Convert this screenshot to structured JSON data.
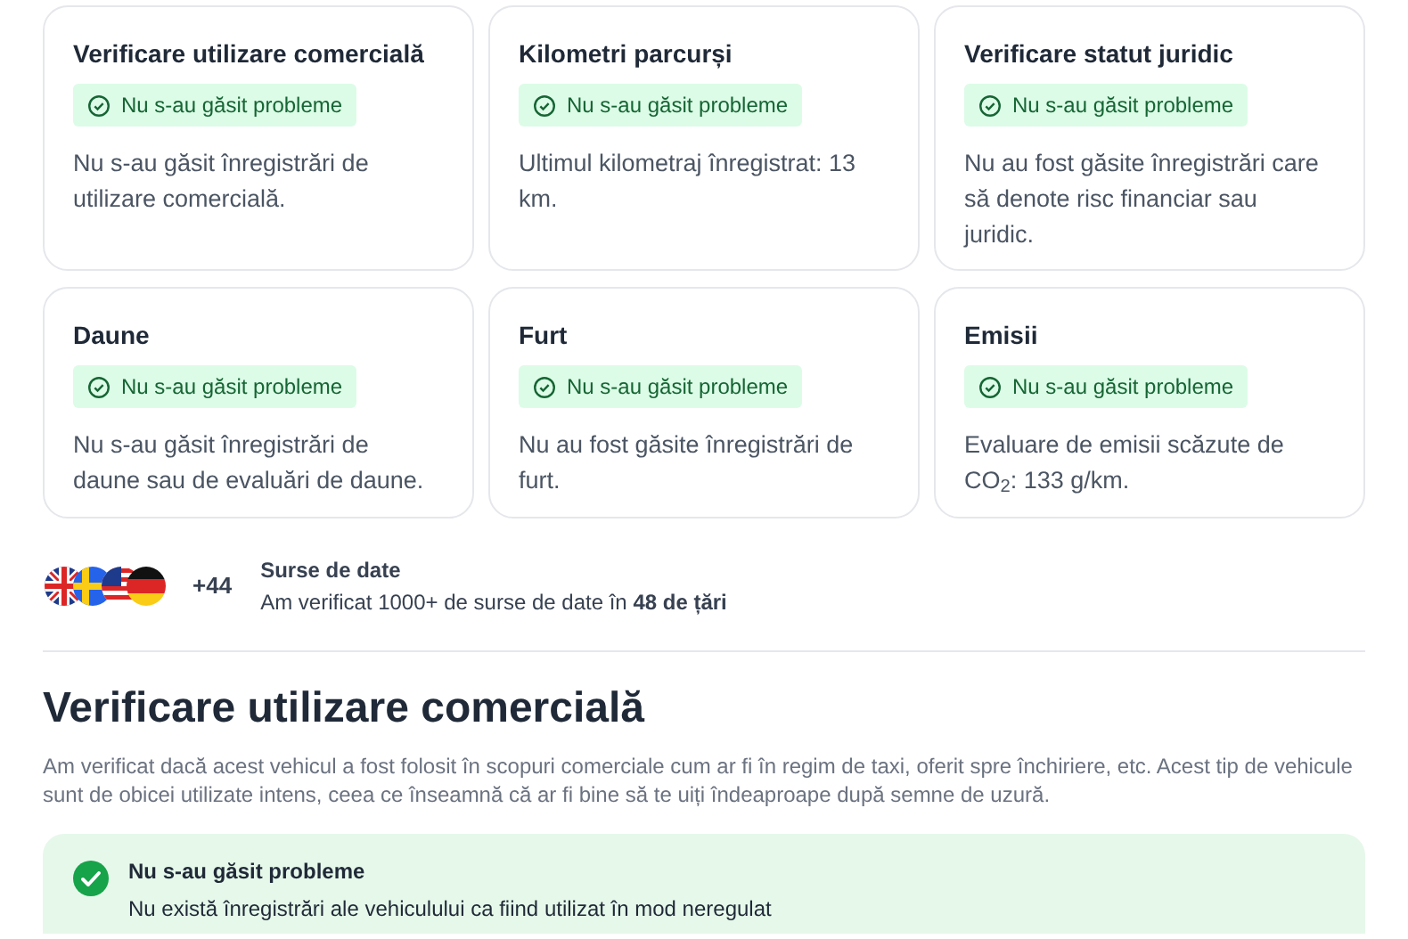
{
  "cards": [
    {
      "title": "Verificare utilizare comercială",
      "kind": "ok",
      "badge": "Nu s-au găsit probleme",
      "text": "Nu s-au găsit înregistrări de utilizare comercială."
    },
    {
      "title": "Kilometri parcurși",
      "kind": "ok",
      "badge": "Nu s-au găsit probleme",
      "text": "Ultimul kilometraj înregistrat: 13 km."
    },
    {
      "title": "Verificare statut juridic",
      "kind": "ok",
      "badge": "Nu s-au găsit probleme",
      "text": "Nu au fost găsite înregistrări care să denote risc financiar sau juridic."
    },
    {
      "title": "Daune",
      "kind": "ok",
      "badge": "Nu s-au găsit probleme",
      "text": "Nu s-au găsit înregistrări de daune sau de evaluări de daune."
    },
    {
      "title": "Furt",
      "kind": "ok",
      "badge": "Nu s-au găsit probleme",
      "text": "Nu au fost găsite înregistrări de furt."
    },
    {
      "title": "Emisii",
      "kind": "ok",
      "badge": "Nu s-au găsit probleme",
      "text": "Evaluare de emisii scăzute de CO$_{2}$: 133 g/km."
    }
  ],
  "sources": {
    "count": "+44",
    "title": "Surse de date",
    "text": "Am verificat 1000+ de surse de date în **48 de țări**"
  },
  "section": {
    "title": "Verificare utilizare comercială",
    "description": "Am verificat dacă acest vehicul a fost folosit în scopuri comerciale cum ar fi în regim de taxi, oferit spre închiriere, etc. Acest tip de vehicule sunt de obicei utilizate intens, ceea ce înseamnă că ar fi bine să te uiți îndeaproape după semne de uzură.",
    "result": {
      "kind": "ok",
      "title": "Nu s-au găsit probleme",
      "text": "Nu există înregistrări ale vehiculului ca fiind utilizat în mod neregulat"
    }
  }
}
